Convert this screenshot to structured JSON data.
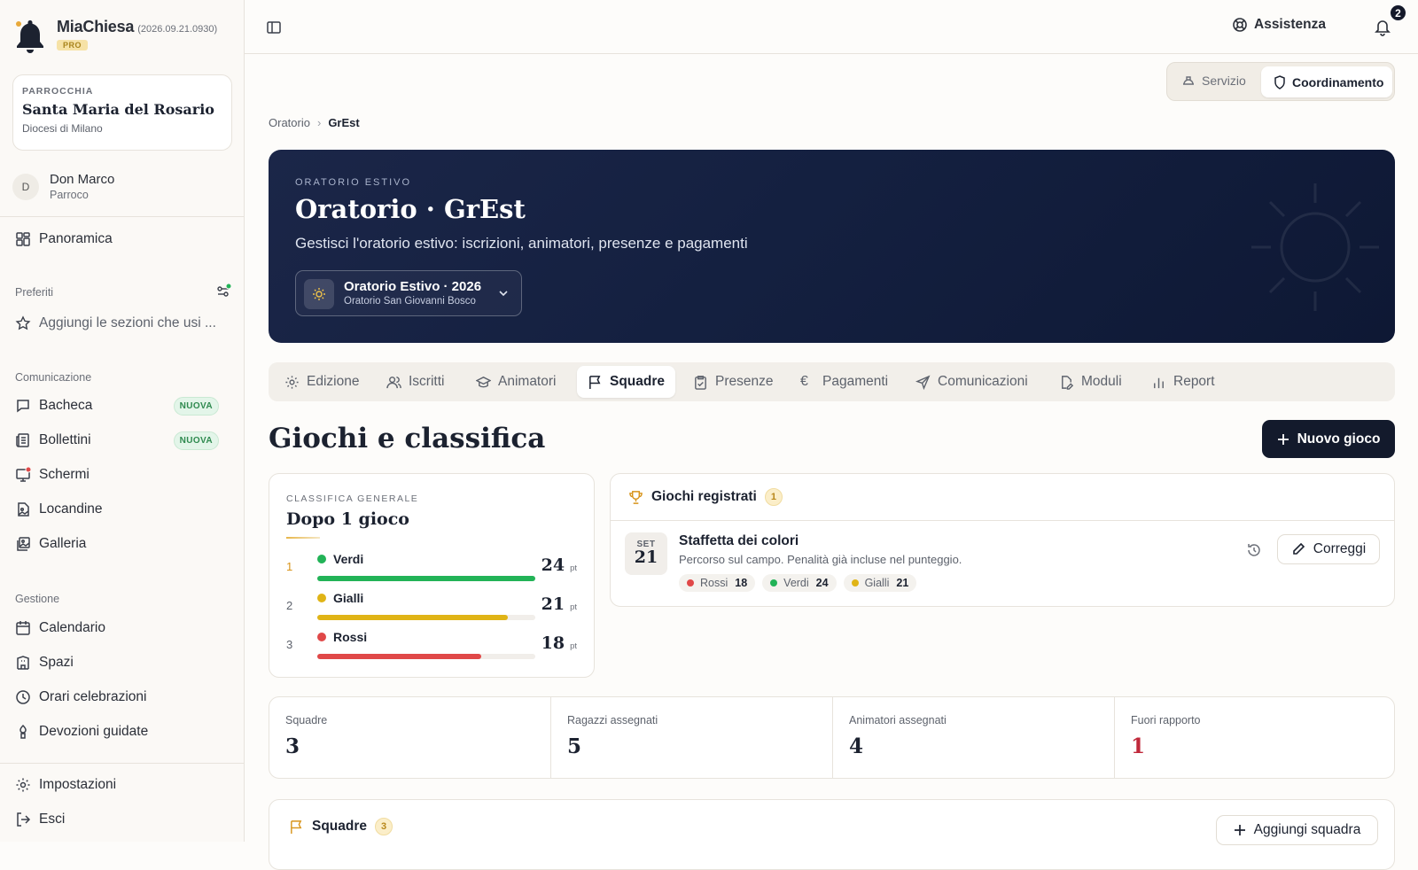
{
  "app": {
    "name": "MiaChiesa",
    "version": "(2026.09.21.0930)",
    "plan": "PRO"
  },
  "parish": {
    "label": "PARROCCHIA",
    "name": "Santa Maria del Rosario",
    "diocese": "Diocesi di Milano"
  },
  "user": {
    "initial": "D",
    "name": "Don Marco",
    "role": "Parroco"
  },
  "sidebar": {
    "overview": "Panoramica",
    "favorites": {
      "title": "Preferiti",
      "placeholder": "Aggiungi le sezioni che usi ..."
    },
    "comm": {
      "title": "Comunicazione",
      "items": [
        {
          "label": "Bacheca",
          "badge": "NUOVA",
          "icon": "message-square-icon"
        },
        {
          "label": "Bollettini",
          "badge": "NUOVA",
          "icon": "newspaper-icon"
        },
        {
          "label": "Schermi",
          "icon": "monitor-icon"
        },
        {
          "label": "Locandine",
          "icon": "file-image-icon"
        },
        {
          "label": "Galleria",
          "icon": "images-icon"
        }
      ]
    },
    "mgmt": {
      "title": "Gestione",
      "items": [
        {
          "label": "Calendario",
          "icon": "calendar-icon"
        },
        {
          "label": "Spazi",
          "icon": "building-icon"
        },
        {
          "label": "Orari celebrazioni",
          "icon": "clock-icon"
        },
        {
          "label": "Devozioni guidate",
          "icon": "candle-icon"
        }
      ]
    },
    "settings": "Impostazioni",
    "logout": "Esci"
  },
  "topbar": {
    "help": "Assistenza",
    "notifications": "2"
  },
  "mode": {
    "service": "Servizio",
    "coordination": "Coordinamento",
    "active": "Coordinamento"
  },
  "breadcrumb": {
    "parent": "Oratorio",
    "current": "GrEst"
  },
  "hero": {
    "eyebrow": "ORATORIO ESTIVO",
    "title": "Oratorio · GrEst",
    "subtitle": "Gestisci l'oratorio estivo: iscrizioni, animatori, presenze e pagamenti",
    "edition": {
      "title": "Oratorio Estivo · 2026",
      "place": "Oratorio San Giovanni Bosco"
    }
  },
  "tabs": [
    {
      "label": "Edizione",
      "icon": "gear-icon"
    },
    {
      "label": "Iscritti",
      "icon": "users-icon"
    },
    {
      "label": "Animatori",
      "icon": "graduation-cap-icon"
    },
    {
      "label": "Squadre",
      "icon": "flag-icon"
    },
    {
      "label": "Presenze",
      "icon": "clipboard-check-icon"
    },
    {
      "label": "Pagamenti",
      "icon": "euro-icon"
    },
    {
      "label": "Comunicazioni",
      "icon": "send-icon"
    },
    {
      "label": "Moduli",
      "icon": "file-edit-icon"
    },
    {
      "label": "Report",
      "icon": "bar-chart-icon"
    }
  ],
  "active_tab": "Squadre",
  "section": {
    "title": "Giochi e classifica",
    "new_game": "Nuovo gioco"
  },
  "standings": {
    "eyebrow": "CLASSIFICA GENERALE",
    "title": "Dopo 1 gioco",
    "unit": "pt",
    "max": 24,
    "rows": [
      {
        "rank": "1",
        "team": "Verdi",
        "points": 24,
        "color": "#22b357"
      },
      {
        "rank": "2",
        "team": "Gialli",
        "points": 21,
        "color": "#e0b416"
      },
      {
        "rank": "3",
        "team": "Rossi",
        "points": 18,
        "color": "#e04848"
      }
    ]
  },
  "games": {
    "title": "Giochi registrati",
    "count": "1",
    "items": [
      {
        "month": "SET",
        "day": "21",
        "name": "Staffetta dei colori",
        "description": "Percorso sul campo. Penalità già incluse nel punteggio.",
        "scores": [
          {
            "team": "Rossi",
            "points": "18",
            "color": "#e04848"
          },
          {
            "team": "Verdi",
            "points": "24",
            "color": "#22b357"
          },
          {
            "team": "Gialli",
            "points": "21",
            "color": "#e0b416"
          }
        ],
        "edit_label": "Correggi"
      }
    ]
  },
  "stats": [
    {
      "label": "Squadre",
      "value": "3"
    },
    {
      "label": "Ragazzi assegnati",
      "value": "5"
    },
    {
      "label": "Animatori assegnati",
      "value": "4"
    },
    {
      "label": "Fuori rapporto",
      "value": "1",
      "color": "#c0283a"
    }
  ],
  "teams": {
    "title": "Squadre",
    "count": "3",
    "add_label": "Aggiungi squadra"
  }
}
